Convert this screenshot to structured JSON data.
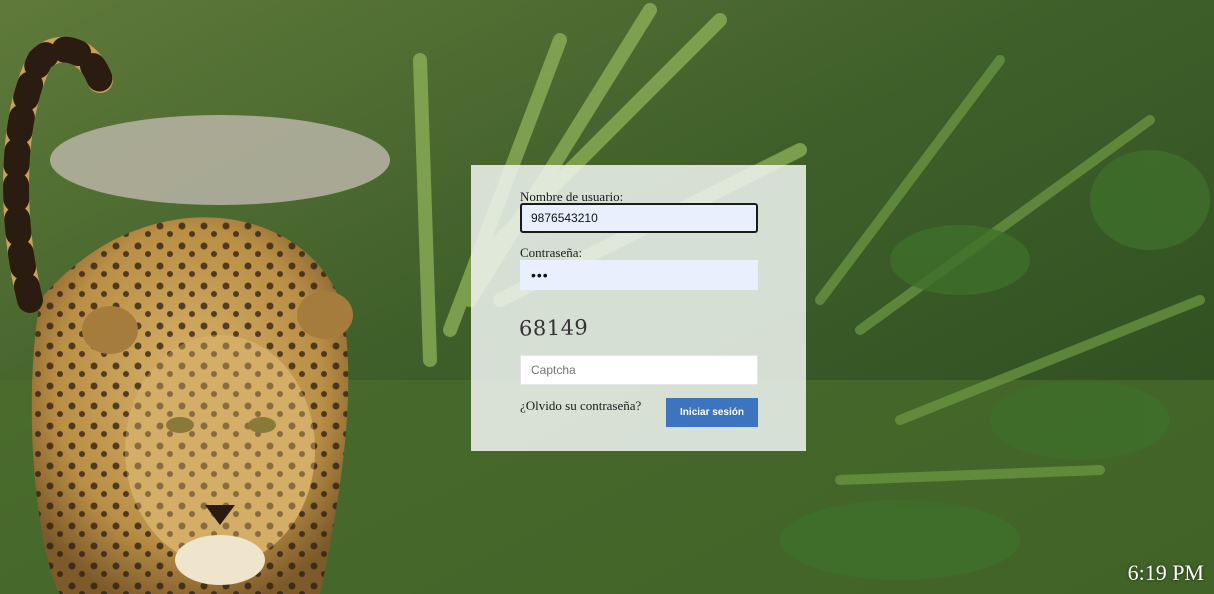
{
  "colors": {
    "panel_background": "#f0f4f0",
    "input_autofill": "#e8f0fe",
    "button": "#3c74bd",
    "clock_text": "#ffffff"
  },
  "login": {
    "username_label": "Nombre de usuario:",
    "username_value": "9876543210",
    "password_label": "Contraseña:",
    "password_value": "•••",
    "captcha_text": "68149",
    "captcha_placeholder": "Captcha",
    "forgot_link": "¿Olvido su contraseña?",
    "submit_label": "Iniciar sesión"
  },
  "taskbar": {
    "clock": "6:19 PM"
  },
  "background": {
    "icon": "jaguar-jungle-wallpaper"
  }
}
